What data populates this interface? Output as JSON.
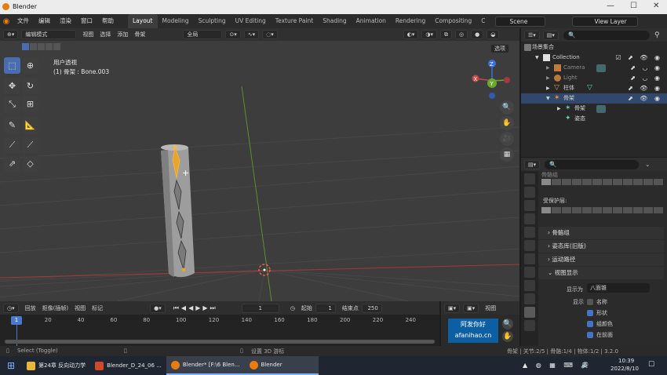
{
  "window": {
    "title": "Blender"
  },
  "menu": {
    "items": [
      "文件",
      "编辑",
      "渲染",
      "窗口",
      "帮助"
    ],
    "workspaces": [
      "Layout",
      "Modeling",
      "Sculpting",
      "UV Editing",
      "Texture Paint",
      "Shading",
      "Animation",
      "Rendering",
      "Compositing",
      "C"
    ],
    "scene": "Scene",
    "viewlayer": "View Layer"
  },
  "vp_header": {
    "mode": "编辑模式",
    "menus": [
      "视图",
      "选择",
      "添加",
      "骨架"
    ],
    "orientation": "全局",
    "options": "选项"
  },
  "viewport": {
    "view_name": "用户透视",
    "active": "(1) 骨架 : Bone.003"
  },
  "gizmo": {
    "x": "X",
    "y": "Y",
    "z": "Z"
  },
  "timeline": {
    "menus": [
      "回放",
      "抠像(插帧)",
      "视图",
      "标记"
    ],
    "current_frame": "1",
    "start_label": "起始",
    "start": "1",
    "end_label": "结束点",
    "end": "250",
    "ticks": [
      "1",
      "20",
      "40",
      "60",
      "80",
      "100",
      "120",
      "140",
      "160",
      "180",
      "200",
      "220",
      "240"
    ]
  },
  "status": {
    "left": "Select (Toggle)",
    "mid": "设置 3D 游标",
    "right": "骨架 | 关节:2/5 | 骨骼:1/4 | 物体:1/2 | 3.2.0"
  },
  "outliner": {
    "root": "场景集合",
    "collection": "Collection",
    "items": [
      {
        "name": "Camera"
      },
      {
        "name": "Light"
      },
      {
        "name": "柱体"
      },
      {
        "name": "骨架"
      },
      {
        "name": "骨架"
      },
      {
        "name": "姿态"
      }
    ]
  },
  "props": {
    "section_label_1": "骨骼组",
    "protected_label": "受保护层:",
    "panels": [
      "骨骼组",
      "姿态库(旧版)",
      "运动路径",
      "视图显示"
    ],
    "display_as_label": "显示为",
    "display_as_value": "八面锥",
    "show_label": "显示",
    "checks": [
      {
        "label": "名称",
        "on": false
      },
      {
        "label": "形状",
        "on": true
      },
      {
        "label": "组颜色",
        "on": true
      },
      {
        "label": "在前面",
        "on": true
      }
    ]
  },
  "viewer_mode": "视图",
  "watermark": {
    "line1": "阿发你好",
    "line2": "afanihao.cn"
  },
  "taskbar": {
    "tasks": [
      "第24章 反向动力学",
      "Blender_D_24_06 ...",
      "Blender* [F:\\6 Blen...",
      "Blender"
    ],
    "ime": "英",
    "time": "10:39",
    "date": "2022/8/10"
  }
}
